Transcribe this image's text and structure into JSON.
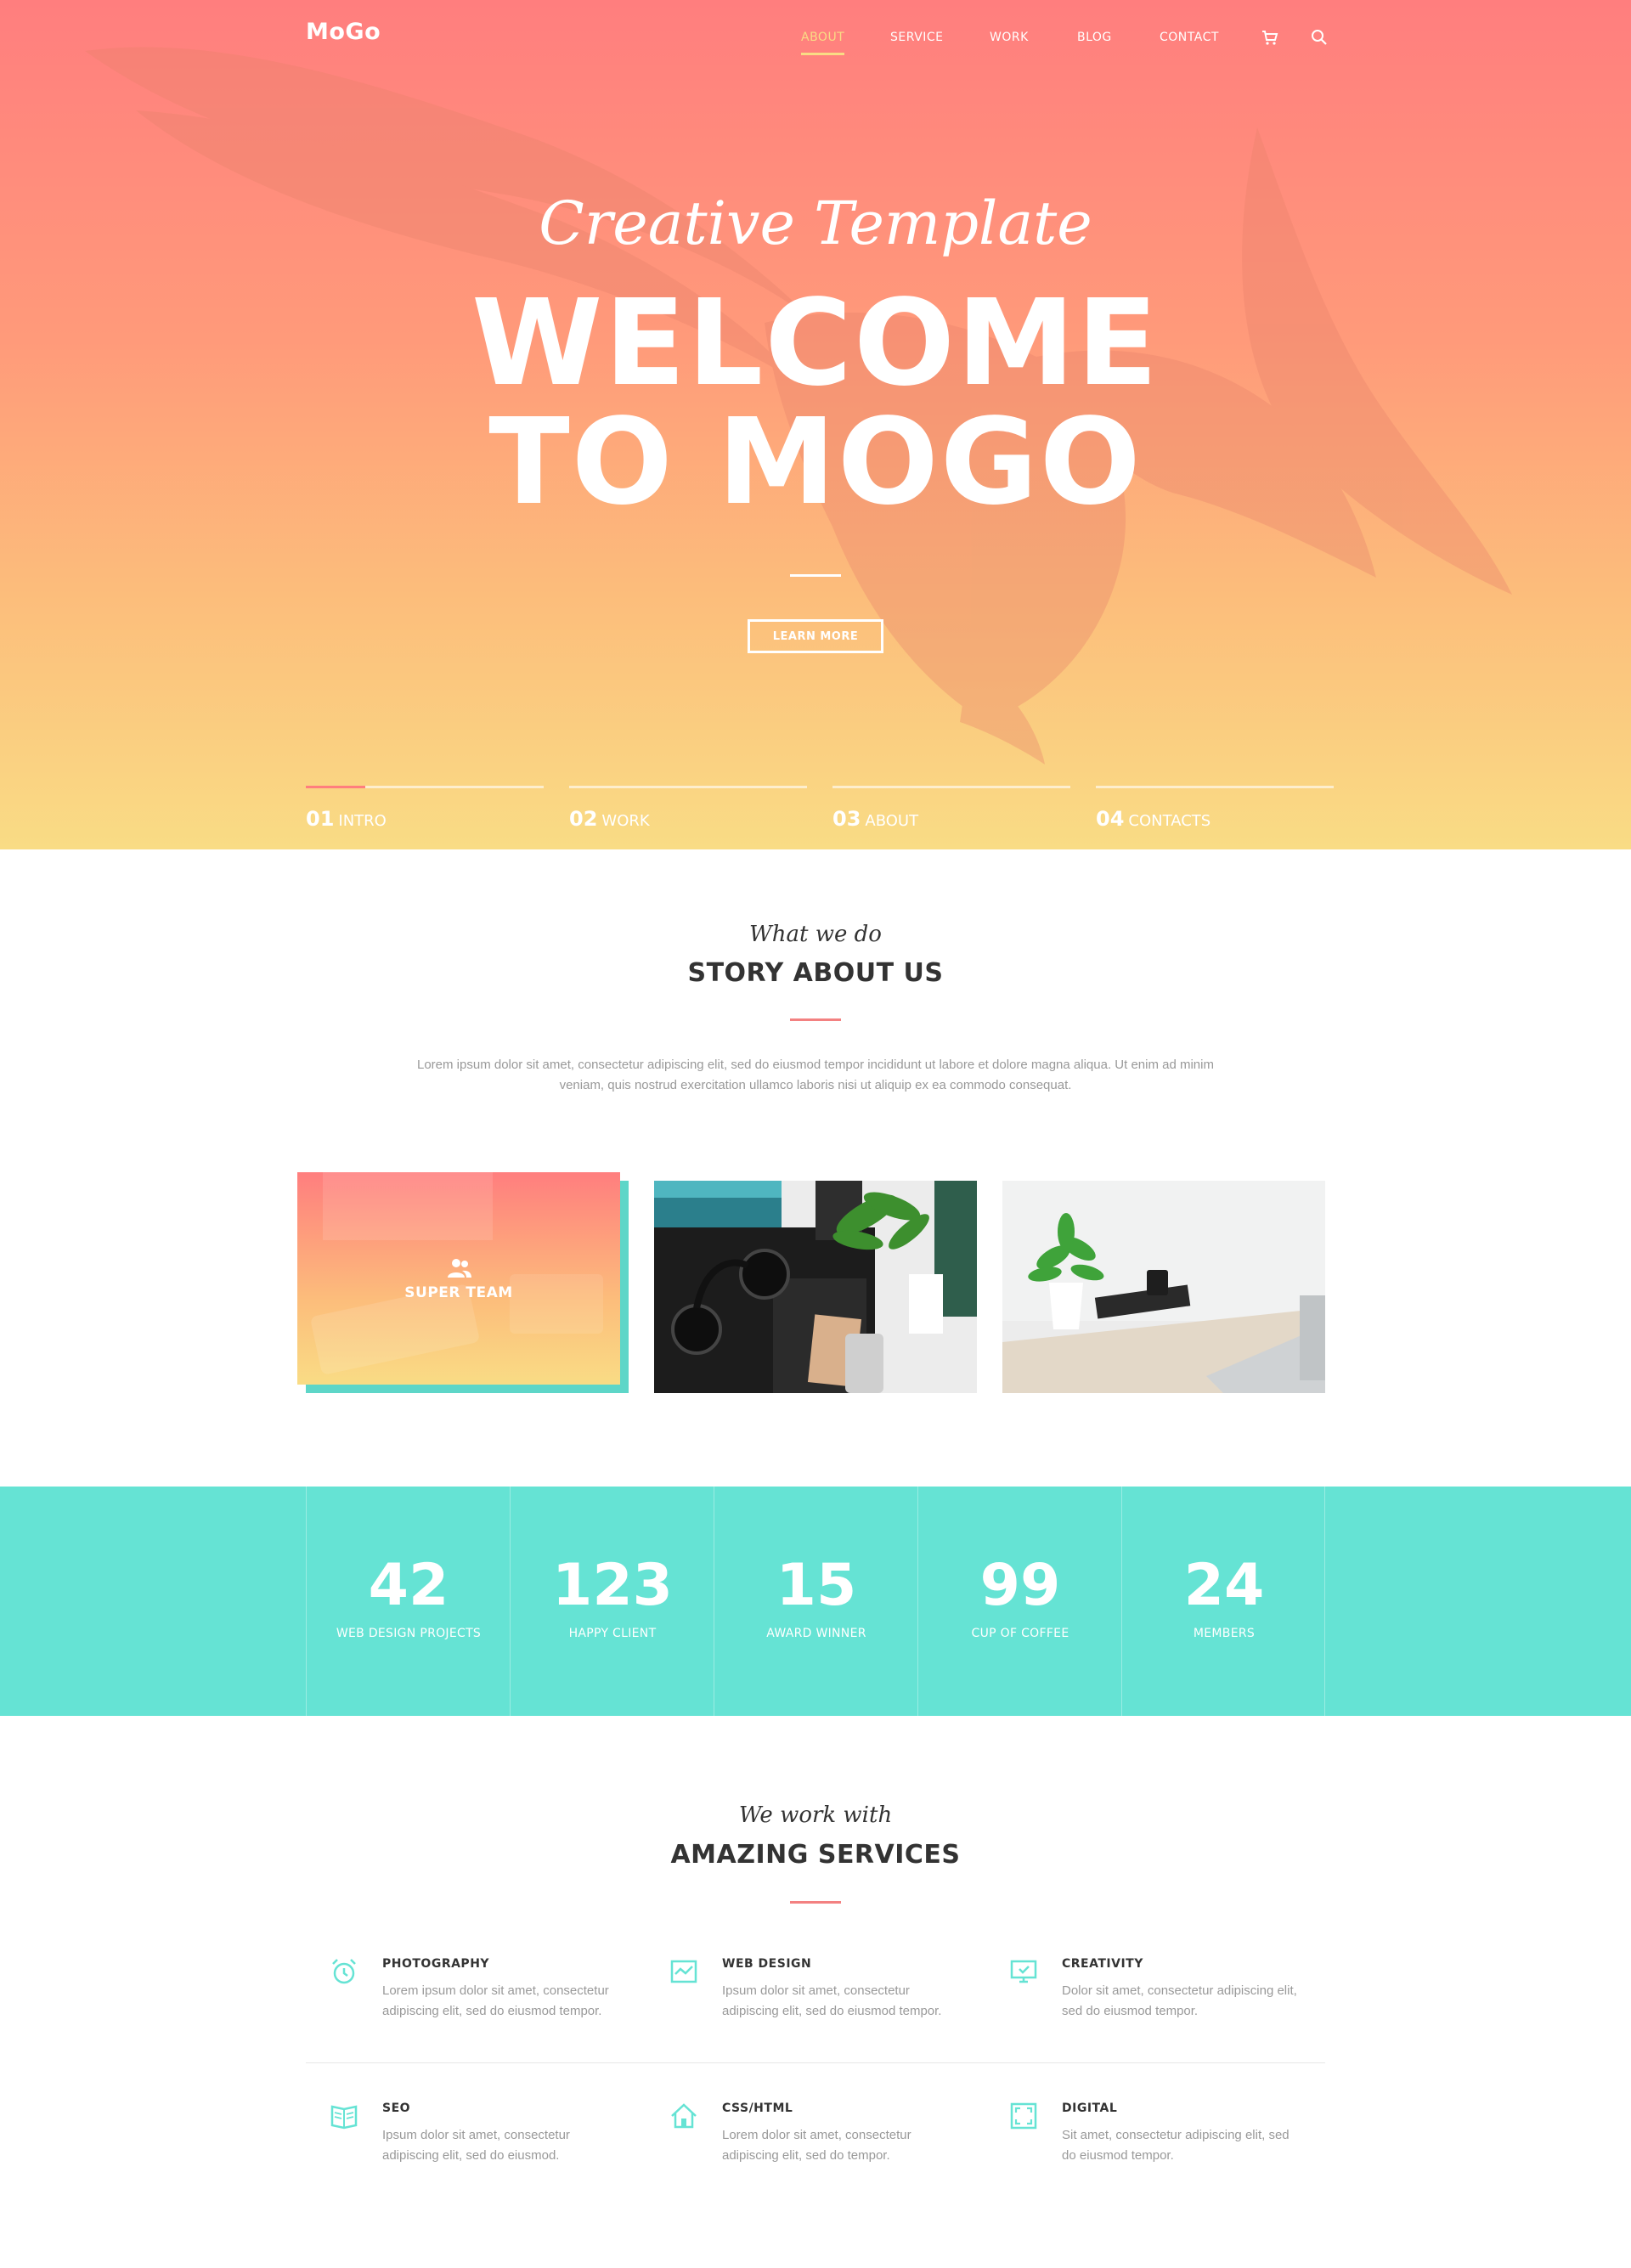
{
  "nav": {
    "logo": "MoGo",
    "items": [
      "ABOUT",
      "SERVICE",
      "WORK",
      "BLOG",
      "CONTACT"
    ],
    "icons": [
      "cart-icon",
      "search-icon"
    ],
    "active_index": 0
  },
  "hero": {
    "script": "Creative Template",
    "title_line1": "WELCOME",
    "title_line2": "TO MOGO",
    "button": "LEARN MORE"
  },
  "slides": [
    {
      "num": "01",
      "label": "INTRO",
      "progress": 0.25
    },
    {
      "num": "02",
      "label": "WORK",
      "progress": 0
    },
    {
      "num": "03",
      "label": "ABOUT",
      "progress": 0
    },
    {
      "num": "04",
      "label": "CONTACTS",
      "progress": 0
    }
  ],
  "about": {
    "sub": "What we do",
    "title": "STORY ABOUT US",
    "text": "Lorem ipsum dolor sit amet, consectetur adipiscing elit, sed do eiusmod tempor incididunt ut labore et dolore magna aliqua. Ut enim ad minim veniam, quis nostrud exercitation ullamco laboris nisi ut aliquip ex ea commodo consequat.",
    "team_label": "SUPER TEAM"
  },
  "stats": [
    {
      "value": "42",
      "label": "WEB DESIGN PROJECTS"
    },
    {
      "value": "123",
      "label": "HAPPY CLIENT"
    },
    {
      "value": "15",
      "label": "AWARD WINNER"
    },
    {
      "value": "99",
      "label": "CUP OF COFFEE"
    },
    {
      "value": "24",
      "label": "MEMBERS"
    }
  ],
  "services": {
    "sub": "We work with",
    "title": "AMAZING SERVICES",
    "items": [
      {
        "title": "PHOTOGRAPHY",
        "text": "Lorem ipsum dolor sit amet, consectetur adipiscing elit, sed do eiusmod tempor.",
        "icon": "alarm-clock-icon"
      },
      {
        "title": "WEB DESIGN",
        "text": "Ipsum dolor sit amet, consectetur adipiscing elit, sed do eiusmod tempor.",
        "icon": "chart-icon"
      },
      {
        "title": "CREATIVITY",
        "text": "Dolor sit amet, consectetur adipiscing elit, sed do eiusmod tempor.",
        "icon": "monitor-icon"
      },
      {
        "title": "SEO",
        "text": "Ipsum dolor sit amet, consectetur adipiscing elit, sed do eiusmod.",
        "icon": "book-icon"
      },
      {
        "title": "CSS/HTML",
        "text": "Lorem dolor sit amet, consectetur adipiscing elit, sed do tempor.",
        "icon": "home-icon"
      },
      {
        "title": "DIGITAL",
        "text": "Sit amet, consectetur adipiscing elit, sed do eiusmod tempor.",
        "icon": "frame-icon"
      }
    ]
  },
  "colors": {
    "accent": "#f38181",
    "teal": "#65e3d4",
    "gradient_top": "#ff7e7e",
    "gradient_bottom": "#f9dc85"
  }
}
